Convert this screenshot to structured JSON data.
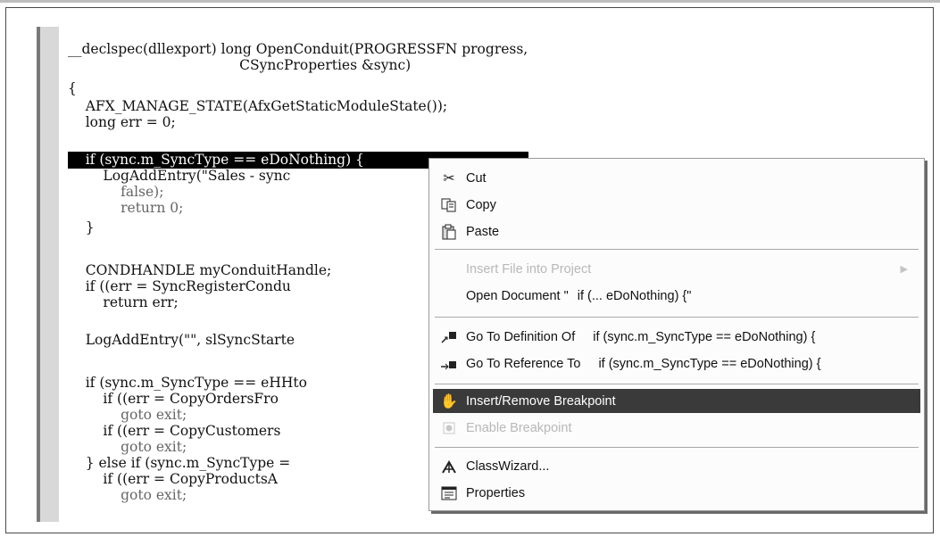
{
  "code": {
    "selected_line": "    if (sync.m_SyncType == eDoNothing) {",
    "lines_before": [
      "__declspec(dllexport) long OpenConduit(PROGRESSFN progress,",
      "                                       CSyncProperties &sync)",
      "{",
      "    AFX_MANAGE_STATE(AfxGetStaticModuleState());",
      "    long err = 0;"
    ],
    "lines_after": [
      "        LogAddEntry(\"Sales - sync",
      "            false);",
      "            return 0;",
      "    }",
      "",
      "    CONDHANDLE myConduitHandle;",
      "    if ((err = SyncRegisterCondu",
      "        return err;",
      "",
      "    LogAddEntry(\"\", slSyncStarte",
      "",
      "    if (sync.m_SyncType == eHHto",
      "        if ((err = CopyOrdersFro",
      "            goto exit;",
      "        if ((err = CopyCustomers",
      "            goto exit;",
      "    } else if (sync.m_SyncType =",
      "        if ((err = CopyProductsA",
      "            goto exit;"
    ]
  },
  "menu": {
    "cut": "Cut",
    "copy": "Copy",
    "paste": "Paste",
    "insert_file": "Insert File into Project",
    "open_document": "Open Document \"",
    "open_document_arg": "if (... eDoNothing) {\"",
    "goto_definition": "Go To Definition Of",
    "goto_definition_arg": "if (sync.m_SyncType == eDoNothing) {",
    "goto_reference": "Go To Reference To",
    "goto_reference_arg": "if (sync.m_SyncType == eDoNothing) {",
    "insert_remove_breakpoint": "Insert/Remove Breakpoint",
    "enable_breakpoint": "Enable Breakpoint",
    "classwizard": "ClassWizard...",
    "properties": "Properties"
  }
}
